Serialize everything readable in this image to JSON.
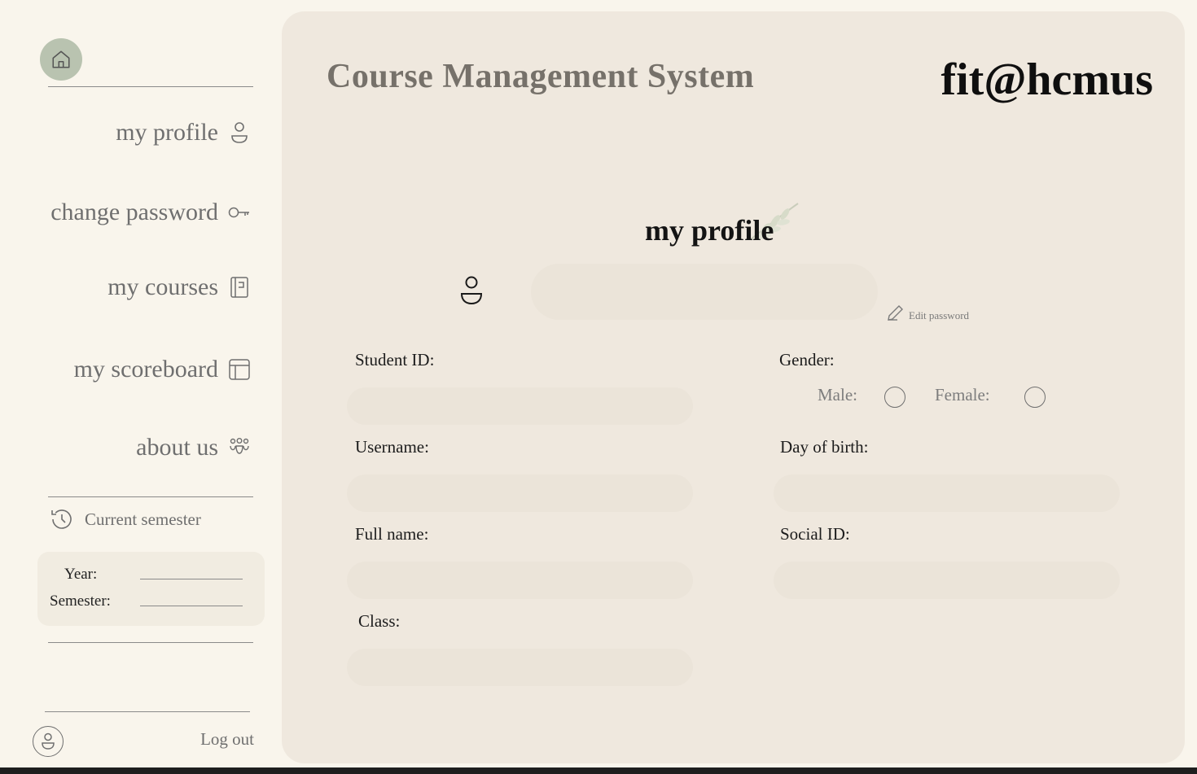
{
  "sidebar": {
    "nav": [
      {
        "label": "my profile",
        "icon": "user-icon"
      },
      {
        "label": "change password",
        "icon": "key-icon"
      },
      {
        "label": "my courses",
        "icon": "notebook-icon"
      },
      {
        "label": "my scoreboard",
        "icon": "table-icon"
      },
      {
        "label": "about us",
        "icon": "people-icon"
      }
    ],
    "semester": {
      "heading": "Current semester",
      "year_label": "Year:",
      "semester_label": "Semester:"
    },
    "logout": "Log out"
  },
  "header": {
    "title": "Course Management System",
    "brand": "fit@hcmus"
  },
  "profile": {
    "title": "my profile",
    "edit_password": "Edit password",
    "fields": {
      "student_id": "Student ID:",
      "username": "Username:",
      "full_name": "Full name:",
      "class": "Class:",
      "gender": "Gender:",
      "male": "Male:",
      "female": "Female:",
      "dob": "Day of birth:",
      "social_id": "Social ID:"
    }
  },
  "colors": {
    "page_bg": "#f9f5ec",
    "panel_bg": "#efe8de",
    "input_bg": "#ebe4d9",
    "home_button": "#b9c3b0",
    "muted_text": "#6f6f6f"
  }
}
